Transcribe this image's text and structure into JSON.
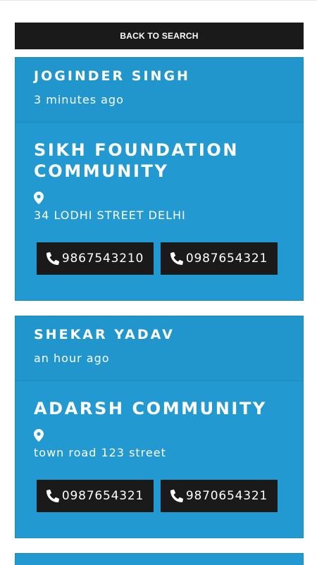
{
  "back_button": {
    "label": "BACK TO SEARCH"
  },
  "posts": [
    {
      "poster": "JOGINDER SINGH",
      "time": "3 minutes ago",
      "community": "SIKH FOUNDATION COMMUNITY",
      "address": "34 LODHI STREET DELHI",
      "phones": [
        "9867543210",
        "0987654321"
      ]
    },
    {
      "poster": "SHEKAR YADAV",
      "time": "an hour ago",
      "community": "ADARSH COMMUNITY",
      "address": "town road 123 street",
      "phones": [
        "0987654321",
        "9870654321"
      ]
    }
  ],
  "icons": {
    "location": "map-marker-icon",
    "phone": "phone-icon"
  },
  "colors": {
    "card_bg": "#2299d0",
    "button_bg": "#1a1a1a",
    "text": "#ffffff"
  }
}
